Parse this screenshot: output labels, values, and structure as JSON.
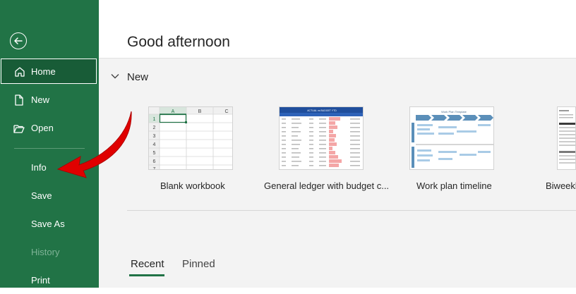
{
  "sidebar": {
    "items": [
      {
        "label": "Home",
        "icon": "home-icon"
      },
      {
        "label": "New",
        "icon": "new-file-icon"
      },
      {
        "label": "Open",
        "icon": "open-folder-icon"
      },
      {
        "label": "Info"
      },
      {
        "label": "Save"
      },
      {
        "label": "Save As"
      },
      {
        "label": "History"
      },
      {
        "label": "Print"
      }
    ],
    "back_icon": "back-arrow-icon"
  },
  "main": {
    "greeting": "Good afternoon",
    "new_section": {
      "title": "New",
      "templates": [
        {
          "label": "Blank workbook",
          "columns": [
            "A",
            "B",
            "C"
          ],
          "rows": [
            "1",
            "2",
            "3",
            "4",
            "5",
            "6",
            "7"
          ]
        },
        {
          "label": "General ledger with budget c...",
          "header_text": "ACTUAL vs BUDGET YTD"
        },
        {
          "label": "Work plan timeline",
          "header_text": "Work Plan Template"
        },
        {
          "label": "Biweekly"
        }
      ]
    },
    "tabs": [
      {
        "label": "Recent",
        "active": true
      },
      {
        "label": "Pinned",
        "active": false
      }
    ]
  },
  "colors": {
    "sidebar": "#217346",
    "sidebar_selected": "#185c37",
    "annotation_arrow": "#e00000",
    "accent": "#217346"
  }
}
